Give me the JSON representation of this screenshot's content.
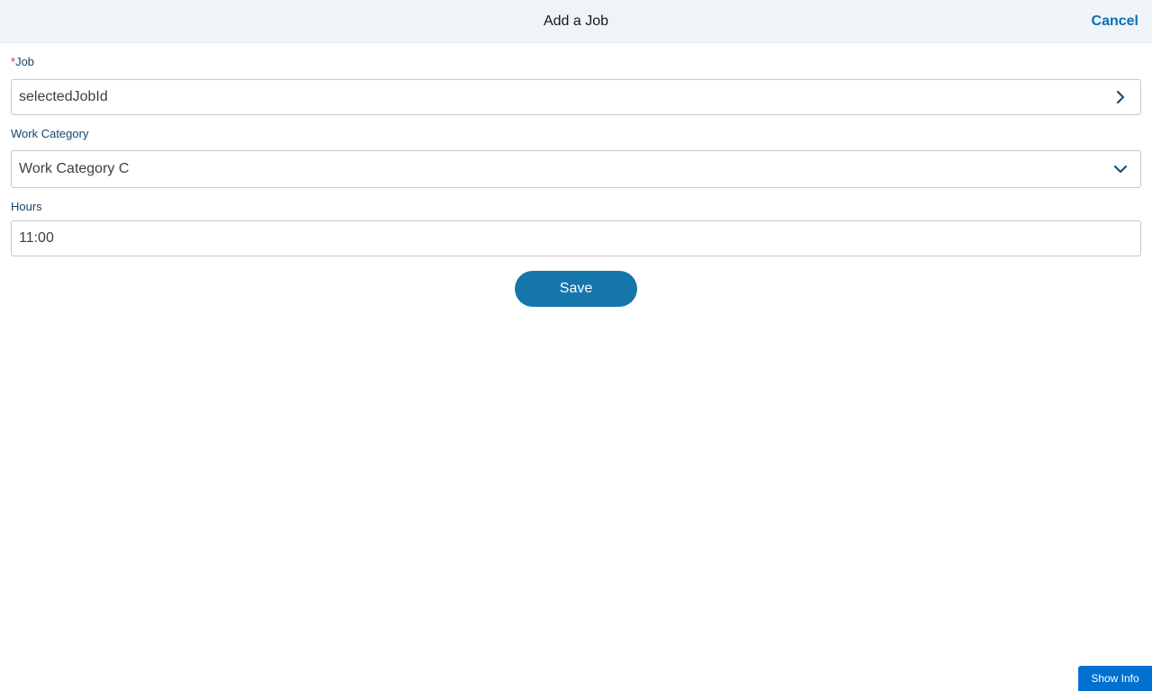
{
  "header": {
    "title": "Add a Job",
    "cancel_label": "Cancel"
  },
  "form": {
    "job": {
      "required_marker": "*",
      "label": "Job",
      "value": "selectedJobId",
      "icon": "chevron-right-icon"
    },
    "work_category": {
      "label": "Work Category",
      "value": "Work Category C",
      "icon": "chevron-down-icon"
    },
    "hours": {
      "label": "Hours",
      "value": "11:00"
    },
    "save_label": "Save"
  },
  "footer": {
    "show_info_label": "Show Info"
  },
  "colors": {
    "header_bg": "#eef4f8",
    "accent": "#0b70b5",
    "save_button": "#1576aa",
    "label": "#19446a",
    "required": "#c23934"
  }
}
